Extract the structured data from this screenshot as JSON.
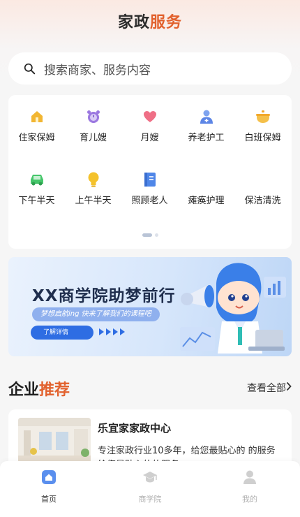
{
  "header": {
    "title_part1": "家政",
    "title_part2": "服务",
    "accent": "#e2612d"
  },
  "search": {
    "placeholder": "搜索商家、服务内容",
    "icon": "search-icon"
  },
  "categories": [
    {
      "label": "住家保姆",
      "icon": "house-icon",
      "color": "#f2b632"
    },
    {
      "label": "育儿嫂",
      "icon": "alarm-clock-icon",
      "color": "#9b78e0"
    },
    {
      "label": "月嫂",
      "icon": "heart-icon",
      "color": "#ef6f86"
    },
    {
      "label": "养老护工",
      "icon": "user-plus-icon",
      "color": "#5d86e6"
    },
    {
      "label": "白班保姆",
      "icon": "pot-icon",
      "color": "#f2a82b"
    },
    {
      "label": "下午半天",
      "icon": "car-icon",
      "color": "#45c66a"
    },
    {
      "label": "上午半天",
      "icon": "lightbulb-icon",
      "color": "#f4c22c"
    },
    {
      "label": "照顾老人",
      "icon": "book-icon",
      "color": "#4f86e8"
    },
    {
      "label": "瘫痪护理",
      "icon": "",
      "color": ""
    },
    {
      "label": "保洁清洗",
      "icon": "",
      "color": ""
    }
  ],
  "pager": {
    "pages": 2,
    "current": 1
  },
  "banner": {
    "title": "XX商学院助梦前行",
    "subtitle": "梦想启航ing 快来了解我们的课程吧",
    "button_label": "了解详情"
  },
  "recommend": {
    "title_part1": "企业",
    "title_part2": "推荐",
    "more_label": "查看全部"
  },
  "business": {
    "name": "乐宜家家政中心",
    "description": "专注家政行业10多年，给您最贴心的 的服务 给您最贴心的的服务"
  },
  "tabbar": {
    "tabs": [
      {
        "label": "首页",
        "icon": "home-icon",
        "active": true
      },
      {
        "label": "商学院",
        "icon": "graduation-cap-icon",
        "active": false
      },
      {
        "label": "我的",
        "icon": "person-icon",
        "active": false
      }
    ]
  }
}
